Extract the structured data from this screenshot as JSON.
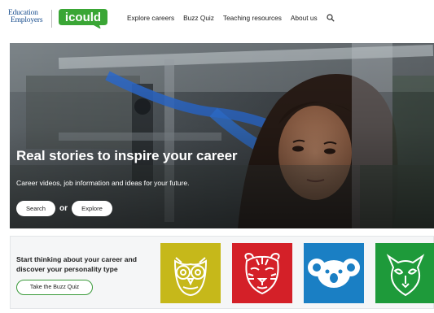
{
  "header": {
    "logo_ee_line1": "Education",
    "logo_ee_line2": "Employers",
    "logo_icould": "icould",
    "nav": [
      {
        "label": "Explore careers"
      },
      {
        "label": "Buzz Quiz"
      },
      {
        "label": "Teaching resources"
      },
      {
        "label": "About us"
      }
    ],
    "search_icon": "search-icon"
  },
  "hero": {
    "title": "Real stories to inspire your career",
    "subtitle": "Career videos, job information and ideas for your future.",
    "search_label": "Search",
    "or_text": "or",
    "explore_label": "Explore"
  },
  "quiz": {
    "heading": "Start thinking about your career and discover your personality type",
    "button_label": "Take the Buzz Quiz",
    "tiles": [
      {
        "icon": "owl-icon",
        "color": "#c6b81a"
      },
      {
        "icon": "tiger-icon",
        "color": "#d42028"
      },
      {
        "icon": "koala-icon",
        "color": "#1a7fc4"
      },
      {
        "icon": "cat-icon",
        "color": "#1e9a3a"
      }
    ]
  },
  "colors": {
    "brand_green": "#3aa635",
    "brand_blue": "#1a4f8f",
    "quiz_border": "#3a9a3a"
  }
}
